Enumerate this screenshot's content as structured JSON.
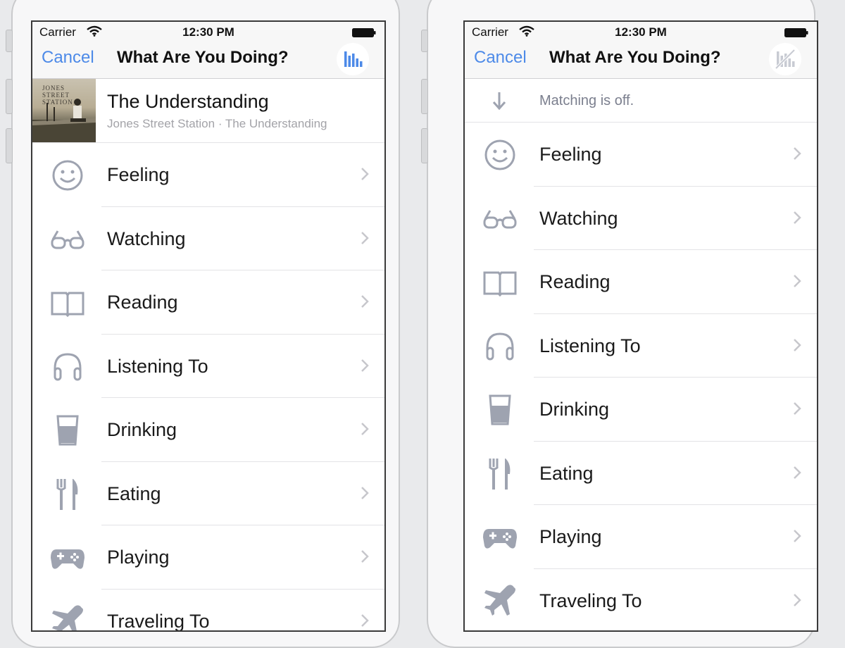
{
  "colors": {
    "accent": "#4d8ae8",
    "icon": "#9ea3b0",
    "chevron": "#c7c7cc"
  },
  "screens": [
    {
      "status": {
        "carrier": "Carrier",
        "time": "12:30 PM"
      },
      "nav": {
        "cancel": "Cancel",
        "title": "What Are You Doing?",
        "match_icon": "sound-bars-icon"
      },
      "now_playing": {
        "art_text": "JONES STREET STATION",
        "title": "The Understanding",
        "subtitle": "Jones Street Station · The Understanding"
      },
      "items": [
        {
          "label": "Feeling",
          "icon": "smiley-icon"
        },
        {
          "label": "Watching",
          "icon": "glasses-icon"
        },
        {
          "label": "Reading",
          "icon": "book-icon"
        },
        {
          "label": "Listening To",
          "icon": "headphones-icon"
        },
        {
          "label": "Drinking",
          "icon": "cup-icon"
        },
        {
          "label": "Eating",
          "icon": "fork-knife-icon"
        },
        {
          "label": "Playing",
          "icon": "gamepad-icon"
        },
        {
          "label": "Traveling To",
          "icon": "airplane-icon"
        }
      ]
    },
    {
      "status": {
        "carrier": "Carrier",
        "time": "12:30 PM"
      },
      "nav": {
        "cancel": "Cancel",
        "title": "What Are You Doing?",
        "match_icon": "sound-bars-off-icon"
      },
      "matching_off": {
        "text": "Matching is off.",
        "icon": "arrow-down-icon"
      },
      "items": [
        {
          "label": "Feeling",
          "icon": "smiley-icon"
        },
        {
          "label": "Watching",
          "icon": "glasses-icon"
        },
        {
          "label": "Reading",
          "icon": "book-icon"
        },
        {
          "label": "Listening To",
          "icon": "headphones-icon"
        },
        {
          "label": "Drinking",
          "icon": "cup-icon"
        },
        {
          "label": "Eating",
          "icon": "fork-knife-icon"
        },
        {
          "label": "Playing",
          "icon": "gamepad-icon"
        },
        {
          "label": "Traveling To",
          "icon": "airplane-icon"
        }
      ]
    }
  ]
}
